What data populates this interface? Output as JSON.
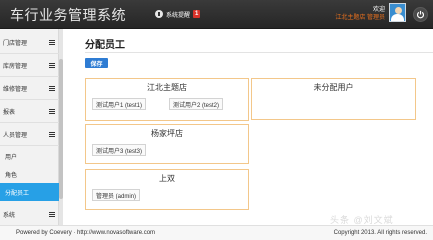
{
  "header": {
    "app_title": "车行业务管理系统",
    "notify_label": "系统提醒",
    "notify_count": "1",
    "welcome": "欢迎",
    "user": "江北主题店 管理员"
  },
  "sidebar": {
    "items": [
      {
        "label": "门店管理"
      },
      {
        "label": "库房管理"
      },
      {
        "label": "维修管理"
      },
      {
        "label": "报表"
      },
      {
        "label": "人员管理"
      }
    ],
    "sub_items": [
      {
        "label": "用户"
      },
      {
        "label": "角色"
      },
      {
        "label": "分配员工"
      }
    ],
    "bottom_item": {
      "label": "系统"
    }
  },
  "main": {
    "title": "分配员工",
    "save_label": "保存",
    "groups": [
      {
        "name": "江北主题店",
        "members": [
          "测试用户1 (test1)",
          "测试用户2 (test2)"
        ]
      },
      {
        "name": "未分配用户",
        "members": []
      },
      {
        "name": "杨家坪店",
        "members": [
          "测试用户3 (test3)"
        ]
      },
      {
        "name": "上双",
        "members": [
          "管理员 (admin)"
        ]
      }
    ]
  },
  "footer": {
    "left": "Powered by Coevery · http://www.novasoftware.com",
    "right": "Copyright 2013. All rights reserved."
  },
  "watermark": "头条 @刘文斌",
  "colors": {
    "header_bg": "#2e2e2e",
    "accent_blue": "#27a0e6",
    "save_button": "#2e7cd3",
    "group_border": "#f3c78a",
    "badge_red": "#d9332b",
    "user_orange": "#e8701e"
  },
  "icons": {
    "notify": "info-icon",
    "menu": "hamburger-icon",
    "power": "power-icon",
    "avatar": "user-avatar-icon"
  }
}
